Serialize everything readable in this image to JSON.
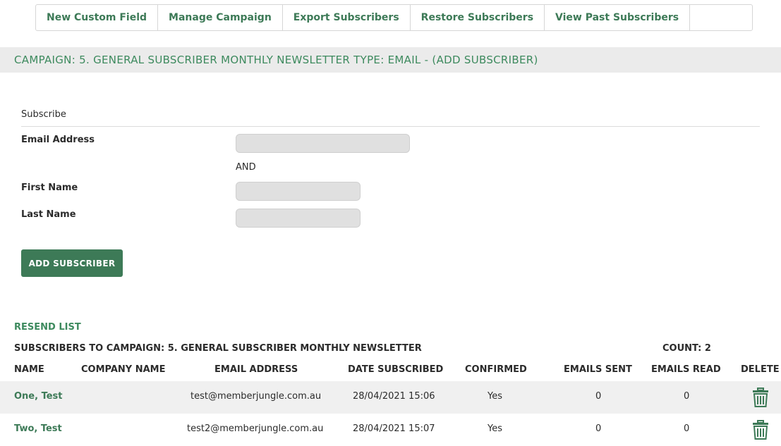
{
  "tabs": [
    {
      "label": "New Custom Field"
    },
    {
      "label": "Manage Campaign"
    },
    {
      "label": "Export Subscribers"
    },
    {
      "label": "Restore Subscribers"
    },
    {
      "label": "View Past Subscribers"
    },
    {
      "label": ""
    }
  ],
  "campaign_header": "CAMPAIGN: 5. GENERAL SUBSCRIBER MONTHLY NEWSLETTER TYPE:  EMAIL - (ADD SUBSCRIBER)",
  "form": {
    "heading": "Subscribe",
    "email_label": "Email Address",
    "email_value": "",
    "and_label": "AND",
    "first_name_label": "First Name",
    "first_name_value": "",
    "last_name_label": "Last Name",
    "last_name_value": "",
    "submit_label": "ADD SUBSCRIBER"
  },
  "resend_label": "RESEND LIST",
  "list_title": "SUBSCRIBERS TO CAMPAIGN: 5. GENERAL SUBSCRIBER MONTHLY NEWSLETTER",
  "count_label": "COUNT: 2",
  "table": {
    "headers": {
      "name": "NAME",
      "company": "COMPANY NAME",
      "email": "EMAIL ADDRESS",
      "date": "DATE SUBSCRIBED",
      "confirmed": "CONFIRMED",
      "sent": "EMAILS SENT",
      "read": "EMAILS READ",
      "delete": "DELETE"
    },
    "rows": [
      {
        "name": "One, Test",
        "company": "",
        "email": "test@memberjungle.com.au",
        "date": "28/04/2021 15:06",
        "confirmed": "Yes",
        "sent": "0",
        "read": "0",
        "delete_icon": "trash-icon"
      },
      {
        "name": "Two, Test",
        "company": "",
        "email": "test2@memberjungle.com.au",
        "date": "28/04/2021 15:07",
        "confirmed": "Yes",
        "sent": "0",
        "read": "0",
        "delete_icon": "trash-icon"
      }
    ]
  },
  "colors": {
    "accent_green": "#3d7a57",
    "header_bar_bg": "#ebebeb",
    "input_bg": "#e0e0e0"
  }
}
